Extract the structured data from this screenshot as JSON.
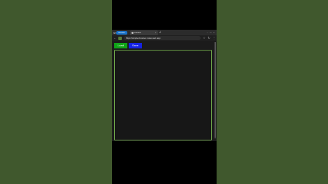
{
  "browser": {
    "tab_group_label": "Ubuntu",
    "active_tab_title": "Untitled",
    "new_tab_symbol": "+",
    "tab_close_symbol": "×",
    "window_controls": [
      "–",
      "□",
      "×"
    ],
    "address": "https://simple-browser-notes.web.app",
    "nav": {
      "back": "←",
      "forward": "→",
      "reload": "↻",
      "star": "☆",
      "menu": "⋮"
    }
  },
  "toolbar": {
    "load_label": "Load",
    "save_label": "Save"
  },
  "colors": {
    "background": "#40582d",
    "load_button": "#0fa317",
    "save_button": "#1522e6",
    "editor_border": "#6fa84a",
    "tab_group": "#1a73c9"
  }
}
